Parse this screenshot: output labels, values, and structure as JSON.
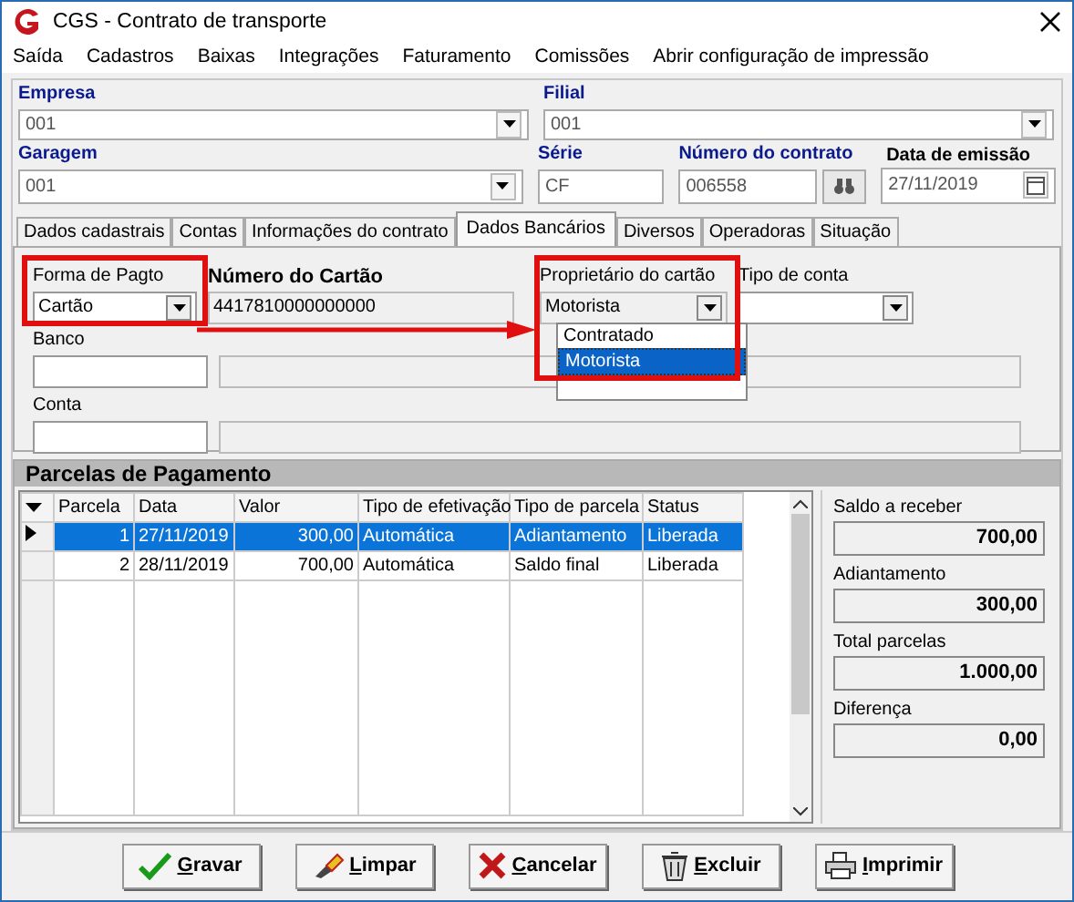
{
  "window": {
    "title": "CGS - Contrato de transporte"
  },
  "menu": [
    "Saída",
    "Cadastros",
    "Baixas",
    "Integrações",
    "Faturamento",
    "Comissões",
    "Abrir configuração de impressão"
  ],
  "header_rows": [
    [
      {
        "label": "Empresa",
        "value": "001",
        "kind": "combo",
        "required": true
      },
      {
        "label": "Filial",
        "value": "001",
        "kind": "combo",
        "required": true
      }
    ],
    [
      {
        "label": "Garagem",
        "value": "001",
        "kind": "combo",
        "required": true
      },
      {
        "label": "Série",
        "value": "CF",
        "kind": "text",
        "required": true
      },
      {
        "label": "Número do contrato",
        "value": "006558",
        "kind": "search",
        "required": true
      },
      {
        "label": "Data de emissão",
        "value": "27/11/2019",
        "kind": "date",
        "required": false
      }
    ]
  ],
  "tabs": [
    {
      "label": "Dados cadastrais",
      "selected": false
    },
    {
      "label": "Contas",
      "selected": false
    },
    {
      "label": "Informações do contrato",
      "selected": false
    },
    {
      "label": "Dados Bancários",
      "selected": true
    },
    {
      "label": "Diversos",
      "selected": false
    },
    {
      "label": "Operadoras",
      "selected": false
    },
    {
      "label": "Situação",
      "selected": false
    }
  ],
  "bank": {
    "forma_pagto": {
      "label": "Forma de Pagto",
      "value": "Cartão"
    },
    "numero_cartao": {
      "label": "Número do Cartão",
      "value": "4417810000000000"
    },
    "proprietario": {
      "label": "Proprietário do cartão",
      "value": "Motorista",
      "options": [
        {
          "label": "Contratado",
          "selected": false
        },
        {
          "label": "Motorista",
          "selected": true
        }
      ]
    },
    "tipo_conta": {
      "label": "Tipo de conta"
    },
    "banco": {
      "label": "Banco"
    },
    "conta": {
      "label": "Conta"
    }
  },
  "parcelas": {
    "title": "Parcelas de Pagamento",
    "columns": [
      "Parcela",
      "Data",
      "Valor",
      "Tipo de efetivação",
      "Tipo de parcela",
      "Status"
    ],
    "rows": [
      {
        "selected": true,
        "cells": [
          "1",
          "27/11/2019",
          "300,00",
          "Automática",
          "Adiantamento",
          "Liberada"
        ]
      },
      {
        "selected": false,
        "cells": [
          "2",
          "28/11/2019",
          "700,00",
          "Automática",
          "Saldo final",
          "Liberada"
        ]
      }
    ],
    "summary": [
      {
        "label": "Saldo a receber",
        "value": "700,00"
      },
      {
        "label": "Adiantamento",
        "value": "300,00"
      },
      {
        "label": "Total parcelas",
        "value": "1.000,00"
      },
      {
        "label": "Diferença",
        "value": "0,00"
      }
    ]
  },
  "buttons": [
    {
      "label": "Gravar"
    },
    {
      "label": "Limpar"
    },
    {
      "label": "Cancelar"
    },
    {
      "label": "Excluir"
    },
    {
      "label": "Imprimir"
    }
  ]
}
